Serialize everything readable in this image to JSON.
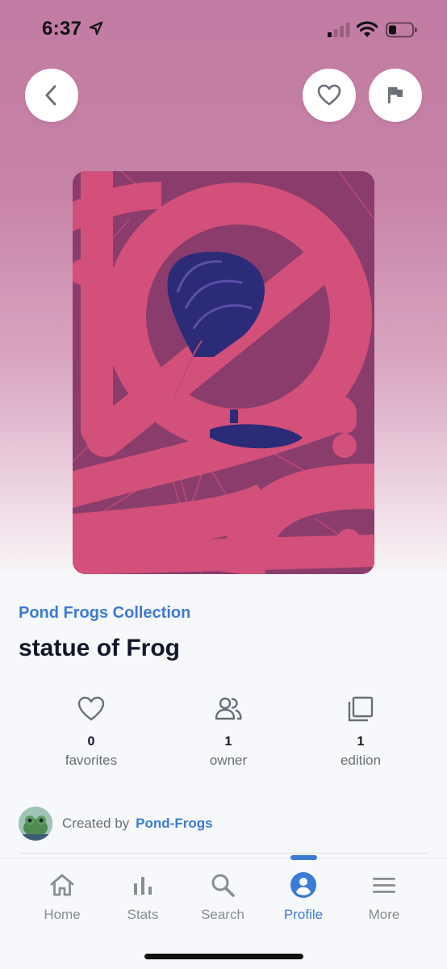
{
  "status_bar": {
    "time": "6:37",
    "icons": [
      "location-arrow-icon",
      "signal-icon",
      "wifi-icon",
      "battery-icon"
    ]
  },
  "header": {
    "buttons": [
      "back-icon",
      "heart-icon",
      "flag-icon"
    ]
  },
  "nft": {
    "collection": "Pond Frogs Collection",
    "title": "statue of Frog",
    "artwork_colors": {
      "background": "#8a3d6c",
      "ribbon": "#d2507a",
      "figure": "#2c2b78"
    }
  },
  "stats": [
    {
      "value": "0",
      "label": "favorites",
      "icon": "heart-outline-icon"
    },
    {
      "value": "1",
      "label": "owner",
      "icon": "users-icon"
    },
    {
      "value": "1",
      "label": "edition",
      "icon": "copies-icon"
    }
  ],
  "creator": {
    "prefix": "Created by",
    "name": "Pond-Frogs"
  },
  "tabbar": {
    "active": "Profile",
    "tabs": [
      {
        "label": "Home",
        "icon": "home-icon"
      },
      {
        "label": "Stats",
        "icon": "bar-chart-icon"
      },
      {
        "label": "Search",
        "icon": "search-icon"
      },
      {
        "label": "Profile",
        "icon": "profile-icon"
      },
      {
        "label": "More",
        "icon": "menu-icon"
      }
    ]
  },
  "colors": {
    "accent": "#3a7bd5",
    "hero_top": "#c27ca3"
  }
}
